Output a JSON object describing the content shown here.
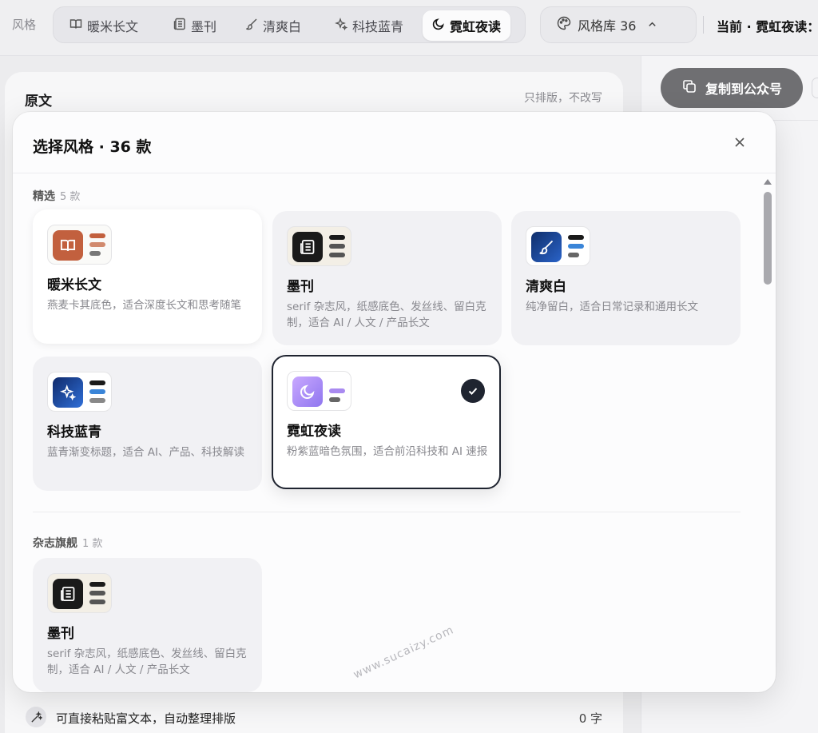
{
  "topbar": {
    "label": "风格",
    "tabs": [
      {
        "label": "暖米长文",
        "icon": "book-icon"
      },
      {
        "label": "墨刊",
        "icon": "newspaper-icon"
      },
      {
        "label": "清爽白",
        "icon": "brush-icon"
      },
      {
        "label": "科技蓝青",
        "icon": "sparkle-icon"
      },
      {
        "label": "霓虹夜读",
        "icon": "moon-icon",
        "active": true
      }
    ],
    "library_label": "风格库 36",
    "current_label": "当前 · 霓虹夜读："
  },
  "left_panel": {
    "title": "原文",
    "note": "只排版，不改写"
  },
  "right_panel": {
    "copy_label": "复制到公众号"
  },
  "bottom_bar": {
    "paste_hint": "可直接粘贴富文本，自动整理排版",
    "word_count": "0 字"
  },
  "modal": {
    "title": "选择风格 · 36 款",
    "sections": [
      {
        "title": "精选",
        "count": "5 款",
        "cards": [
          {
            "name": "暖米长文",
            "desc": "燕麦卡其底色，适合深度长文和思考随笔",
            "icon": "book-icon",
            "accent": "#c2603e"
          },
          {
            "name": "墨刊",
            "desc": "serif 杂志风，纸感底色、发丝线、留白克制，适合 AI / 人文 / 产品长文",
            "icon": "newspaper-icon",
            "accent": "#1a1a1a"
          },
          {
            "name": "清爽白",
            "desc": "纯净留白，适合日常记录和通用长文",
            "icon": "brush-icon",
            "accent": "#1f4fa0"
          },
          {
            "name": "科技蓝青",
            "desc": "蓝青渐变标题，适合 AI、产品、科技解读",
            "icon": "sparkle-icon",
            "accent": "#1d4aa8"
          },
          {
            "name": "霓虹夜读",
            "desc": "粉紫蓝暗色氛围，适合前沿科技和 AI 速报",
            "icon": "moon-icon",
            "accent": "#a98af0",
            "selected": true
          }
        ]
      },
      {
        "title": "杂志旗舰",
        "count": "1 款",
        "cards": [
          {
            "name": "墨刊",
            "desc": "serif 杂志风，纸感底色、发丝线、留白克制，适合 AI / 人文 / 产品长文",
            "icon": "newspaper-icon",
            "accent": "#1a1a1a"
          }
        ]
      }
    ]
  },
  "watermark": "www.sucaizy.com"
}
